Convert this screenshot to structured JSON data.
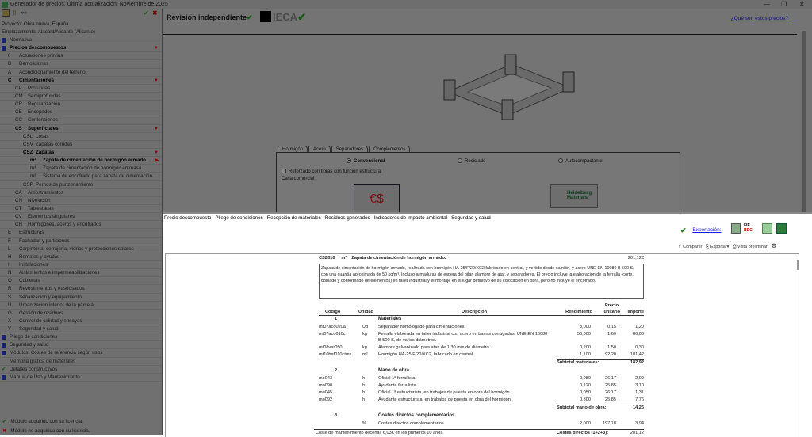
{
  "window": {
    "title": "Generador de precios. Última actualización: Noviembre de 2025"
  },
  "left": {
    "project": "Proyecto: Obra nueva, España",
    "location": "Emplazamiento: Alacant/Alicante (Alicante)",
    "tree": [
      {
        "code": "",
        "label": "Normativa",
        "level": 0,
        "icon": true
      },
      {
        "code": "",
        "label": "Precios descompuestos",
        "level": 0,
        "icon": true,
        "bold": true,
        "open": true
      },
      {
        "code": "0",
        "label": "Actuaciones previas",
        "level": 1
      },
      {
        "code": "D",
        "label": "Demoliciones",
        "level": 1
      },
      {
        "code": "A",
        "label": "Acondicionamiento del terreno",
        "level": 1
      },
      {
        "code": "C",
        "label": "Cimentaciones",
        "level": 1,
        "bold": true,
        "open": true
      },
      {
        "code": "CP",
        "label": "Profundas",
        "level": 2
      },
      {
        "code": "CM",
        "label": "Semiprofundas",
        "level": 2
      },
      {
        "code": "CR",
        "label": "Regularización",
        "level": 2
      },
      {
        "code": "CE",
        "label": "Encepados",
        "level": 2
      },
      {
        "code": "CC",
        "label": "Contenciones",
        "level": 2
      },
      {
        "code": "CS",
        "label": "Superficiales",
        "level": 2,
        "bold": true,
        "open": true
      },
      {
        "code": "CSL",
        "label": "Losas",
        "level": 3
      },
      {
        "code": "CSV",
        "label": "Zapatas corridas",
        "level": 3
      },
      {
        "code": "CSZ",
        "label": "Zapatas",
        "level": 3,
        "bold": true,
        "open": true
      },
      {
        "code": "m³",
        "label": "Zapata de cimentación de hormigón armado.",
        "level": 4,
        "bold": true,
        "selected": true
      },
      {
        "code": "m³",
        "label": "Zapata de cimentación de hormigón en masa.",
        "level": 4
      },
      {
        "code": "m²",
        "label": "Sistema de encofrado para zapata de cimentación.",
        "level": 4
      },
      {
        "code": "CSP",
        "label": "Pernos de punzonamiento",
        "level": 3
      },
      {
        "code": "CA",
        "label": "Arriostramientos",
        "level": 2
      },
      {
        "code": "CN",
        "label": "Nivelación",
        "level": 2
      },
      {
        "code": "CT",
        "label": "Tablestacas",
        "level": 2
      },
      {
        "code": "CV",
        "label": "Elementos singulares",
        "level": 2
      },
      {
        "code": "CH",
        "label": "Hormigones, aceros y encofrados",
        "level": 2
      },
      {
        "code": "E",
        "label": "Estructuras",
        "level": 1
      },
      {
        "code": "F",
        "label": "Fachadas y particiones",
        "level": 1
      },
      {
        "code": "L",
        "label": "Carpintería, cerrajería, vidrios y protecciones solares",
        "level": 1
      },
      {
        "code": "H",
        "label": "Remates y ayudas",
        "level": 1
      },
      {
        "code": "I",
        "label": "Instalaciones",
        "level": 1
      },
      {
        "code": "N",
        "label": "Aislamientos e impermeabilizaciones",
        "level": 1
      },
      {
        "code": "Q",
        "label": "Cubiertas",
        "level": 1
      },
      {
        "code": "R",
        "label": "Revestimientos y trasdosados",
        "level": 1
      },
      {
        "code": "S",
        "label": "Señalización y equipamiento",
        "level": 1
      },
      {
        "code": "U",
        "label": "Urbanización interior de la parcela",
        "level": 1
      },
      {
        "code": "G",
        "label": "Gestión de residuos",
        "level": 1
      },
      {
        "code": "X",
        "label": "Control de calidad y ensayos",
        "level": 1
      },
      {
        "code": "Y",
        "label": "Seguridad y salud",
        "level": 1
      },
      {
        "code": "",
        "label": "Pliego de condiciones",
        "level": 0,
        "icon": true
      },
      {
        "code": "",
        "label": "Seguridad y salud",
        "level": 0,
        "icon": true
      },
      {
        "code": "",
        "label": "Módulos. Costes de referencia según usos",
        "level": 0,
        "icon": true
      },
      {
        "code": "",
        "label": "Memoria gráfica de materiales",
        "level": 0
      },
      {
        "code": "",
        "label": "Detalles constructivos",
        "level": 0,
        "check": true
      },
      {
        "code": "",
        "label": "Manual de Uso y Mantenimiento",
        "level": 0,
        "icon": true
      }
    ],
    "legend_acquired": "Módulo adquirido con su licencia.",
    "legend_not_acquired": "Módulo no adquirido con su licencia."
  },
  "top": {
    "review": "Revisión independiente",
    "ieca": "IECA",
    "help_link": "¿Qué son estos precios?",
    "tabs": [
      "Hormigón",
      "Acero",
      "Separadores",
      "Complementos"
    ],
    "radios": [
      "Convencional",
      "Reciclado",
      "Autocompactante"
    ],
    "checkbox": "Reforzado con fibras con función estructural",
    "group": "Casa comercial",
    "brand": "Heidelberg Materials"
  },
  "bottom": {
    "tabs": [
      "Precio descompuesto",
      "Pliego de condiciones",
      "Recepción de materiales",
      "Residuos generados",
      "Indicadores de impacto ambiental",
      "Seguridad y salud"
    ],
    "export_label": "Exportación:",
    "fie": "FIE",
    "bdc": "BDC",
    "share": "Compartir",
    "export": "Exportar",
    "preview": "Vista preliminar"
  },
  "doc": {
    "code": "CSZ010",
    "unit": "m³",
    "title": "Zapata de cimentación de hormigón armado.",
    "price": "201,12€",
    "description": "Zapata de cimentación de hormigón armado, realizada con hormigón HA-25/F/20/XC2 fabricado en central, y vertido desde camión, y acero UNE-EN 10080 B 500 S, con una cuantía aproximada de 50 kg/m³. Incluso armaduras de espera del pilar, alambre de atar, y separadores. El precio incluye la elaboración de la ferralla (corte, doblado y conformado de elementos) en taller industrial y el montaje en el lugar definitivo de su colocación en obra, pero no incluye el encofrado.",
    "headers": {
      "code": "Código",
      "unit": "Unidad",
      "desc": "Descripción",
      "yield": "Rendimiento",
      "price1": "Precio",
      "price2": "unitario",
      "amount": "Importe"
    },
    "rows": [
      {
        "type": "group",
        "num": "1",
        "desc": "Materiales"
      },
      {
        "code": "mt07aco020a",
        "unit": "Ud",
        "desc": "Separador homologado para cimentaciones.",
        "yield": "8,000",
        "price": "0,15",
        "amount": "1,20"
      },
      {
        "code": "mt07aco010c",
        "unit": "kg",
        "desc": "Ferralla elaborada en taller industrial con acero en barras corrugadas, UNE-EN 10080",
        "desc2": "B 500 S, de varios diámetros.",
        "yield": "50,000",
        "price": "1,60",
        "amount": "80,00"
      },
      {
        "code": "mt08var050",
        "unit": "kg",
        "desc": "Alambre galvanizado para atar, de 1,30 mm de diámetro.",
        "yield": "0,200",
        "price": "1,50",
        "amount": "0,30"
      },
      {
        "code": "mt10haf010ctms",
        "unit": "m³",
        "desc": "Hormigón HA-25/F/20/XC2, fabricado en central.",
        "yield": "1,100",
        "price": "92,20",
        "amount": "101,42"
      },
      {
        "type": "subtotal",
        "label": "Subtotal materiales:",
        "amount": "182,92"
      },
      {
        "type": "group",
        "num": "2",
        "desc": "Mano de obra"
      },
      {
        "code": "mo043",
        "unit": "h",
        "desc": "Oficial 1ª ferrallista.",
        "yield": "0,080",
        "price": "26,17",
        "amount": "2,09"
      },
      {
        "code": "mo090",
        "unit": "h",
        "desc": "Ayudante ferrallista.",
        "yield": "0,120",
        "price": "25,85",
        "amount": "3,10"
      },
      {
        "code": "mo045",
        "unit": "h",
        "desc": "Oficial 1ª estructurista, en trabajos de puesta en obra del hormigón.",
        "yield": "0,050",
        "price": "26,17",
        "amount": "1,31"
      },
      {
        "code": "mo092",
        "unit": "h",
        "desc": "Ayudante estructurista, en trabajos de puesta en obra del hormigón.",
        "yield": "0,300",
        "price": "25,85",
        "amount": "7,76"
      },
      {
        "type": "subtotal",
        "label": "Subtotal mano de obra:",
        "amount": "14,26"
      },
      {
        "type": "group",
        "num": "3",
        "desc": "Costes directos complementarios"
      },
      {
        "code": "",
        "unit": "%",
        "desc": "Costes directos complementarios",
        "yield": "2,000",
        "price": "197,18",
        "amount": "3,94"
      }
    ],
    "maintenance": "Coste de mantenimiento decenal: 6,03€ en los primeros 10 años.",
    "direct_label": "Costes directos (1+2+3):",
    "direct_amount": "201,12"
  }
}
